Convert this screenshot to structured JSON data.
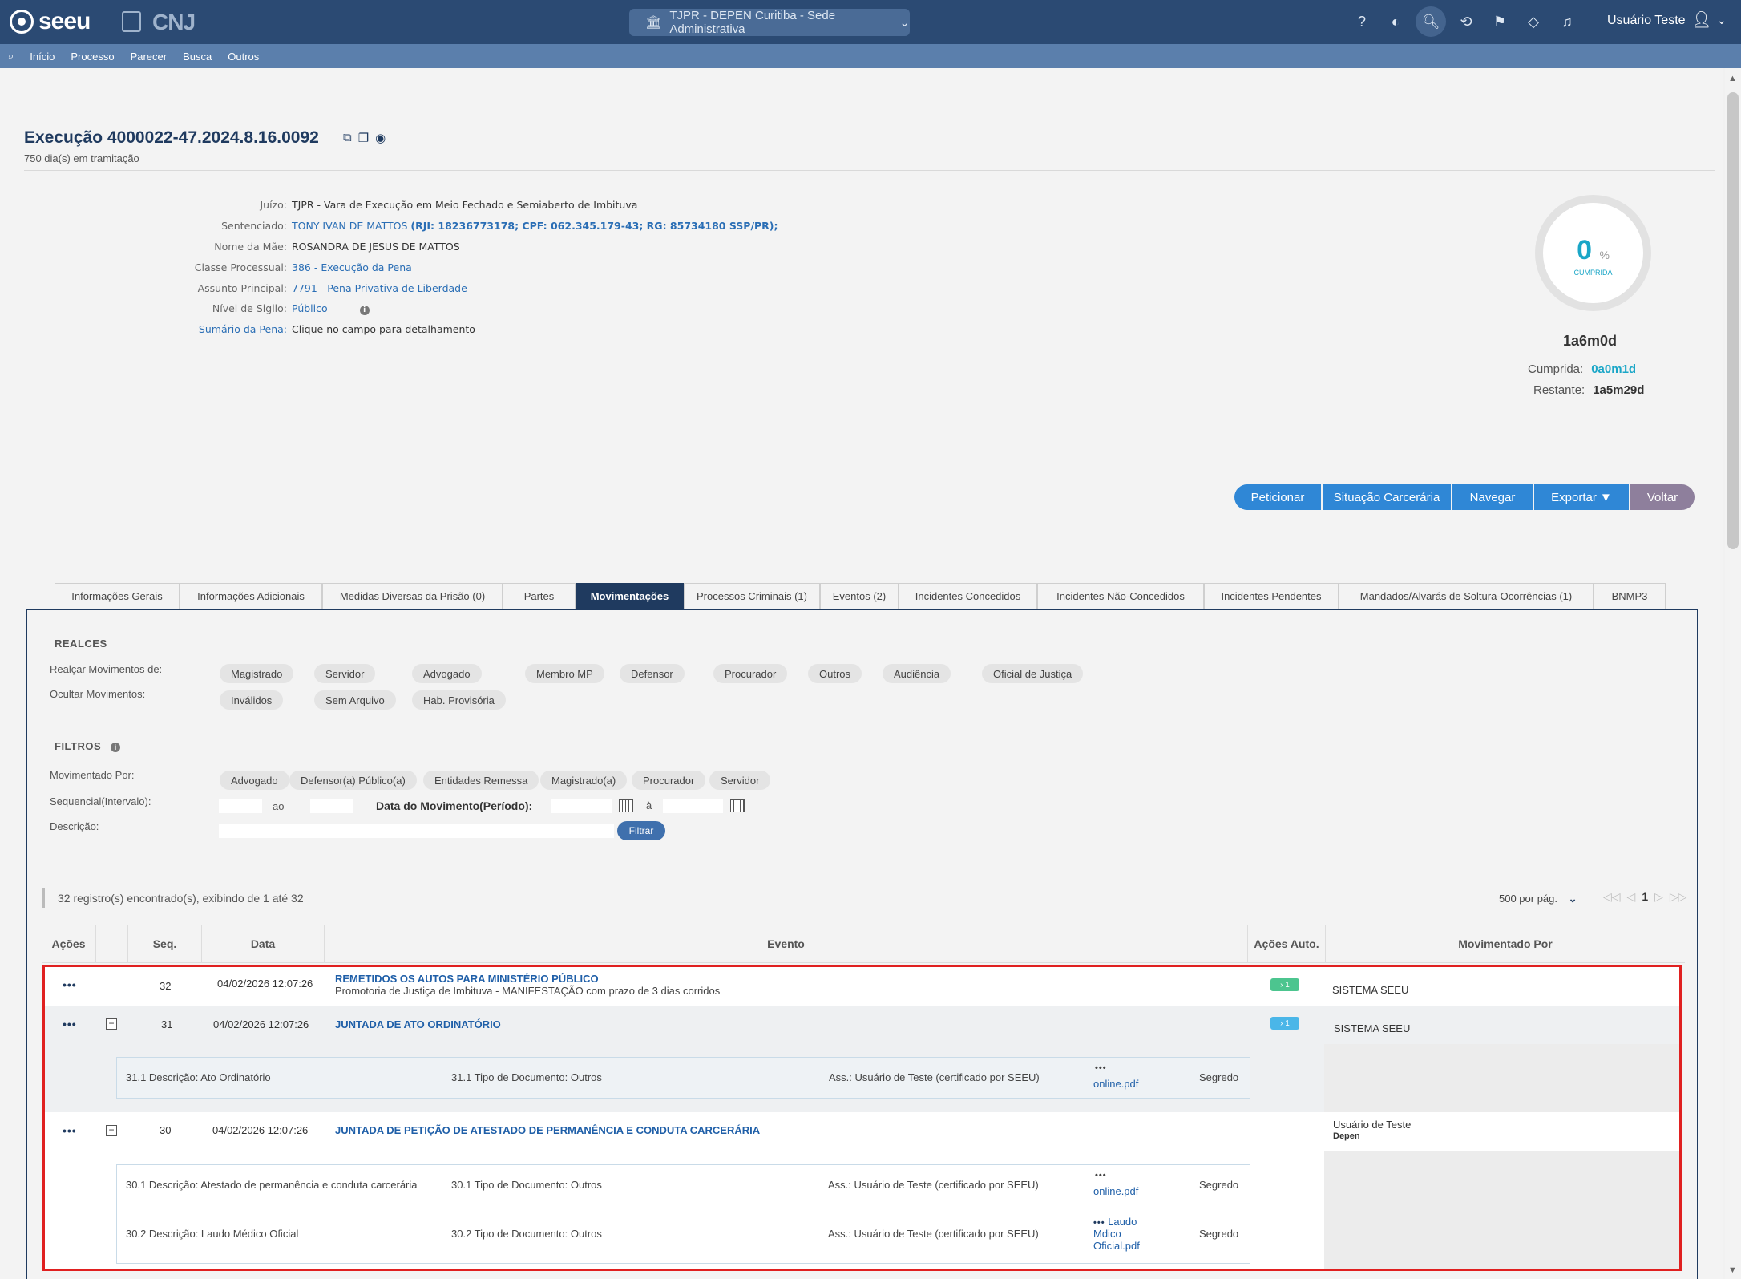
{
  "header": {
    "logo": "seeu",
    "cnj": "CNJ",
    "org_select": "TJPR - DEPEN Curitiba - Sede Administrativa",
    "user_name": "Usuário Teste"
  },
  "nav": {
    "items": [
      "Início",
      "Processo",
      "Parecer",
      "Busca",
      "Outros"
    ]
  },
  "page": {
    "title": "Execução 4000022-47.2024.8.16.0092",
    "subtitle": "750 dia(s) em tramitação"
  },
  "info": {
    "juizo_label": "Juízo:",
    "juizo": "TJPR - Vara de Execução em Meio Fechado e Semiaberto de Imbituva",
    "sentenciado_label": "Sentenciado:",
    "sentenciado_name": "TONY IVAN DE MATTOS",
    "sentenciado_docs": "(RJI: 18236773178; CPF: 062.345.179-43; RG: 85734180 SSP/PR);",
    "mae_label": "Nome da Mãe:",
    "mae": "ROSANDRA DE JESUS DE MATTOS",
    "classe_label": "Classe Processual:",
    "classe": "386 - Execução da Pena",
    "assunto_label": "Assunto Principal:",
    "assunto": "7791 - Pena Privativa de Liberdade",
    "sigilo_label": "Nível de Sigilo:",
    "sigilo": "Público",
    "sumario_label": "Sumário da Pena:",
    "sumario": "Clique no campo para detalhamento"
  },
  "pena": {
    "percent": "0",
    "percent_sign": "%",
    "gauge_label": "CUMPRIDA",
    "total": "1a6m0d",
    "cumprida_label": "Cumprida:",
    "cumprida": "0a0m1d",
    "restante_label": "Restante:",
    "restante": "1a5m29d"
  },
  "actions": [
    "Peticionar",
    "Situação Carcerária",
    "Navegar",
    "Exportar ▼",
    "Voltar"
  ],
  "tabs": [
    "Informações Gerais",
    "Informações Adicionais",
    "Medidas Diversas da Prisão (0)",
    "Partes",
    "Movimentações",
    "Processos Criminais (1)",
    "Eventos (2)",
    "Incidentes Concedidos",
    "Incidentes Não-Concedidos",
    "Incidentes Pendentes",
    "Mandados/Alvarás de Soltura-Ocorrências (1)",
    "BNMP3"
  ],
  "realces": {
    "title": "REALCES",
    "realcar_label": "Realçar Movimentos de:",
    "realcar": [
      "Magistrado",
      "Servidor",
      "Advogado",
      "Membro MP",
      "Defensor",
      "Procurador",
      "Outros",
      "Audiência",
      "Oficial de Justiça"
    ],
    "ocultar_label": "Ocultar Movimentos:",
    "ocultar": [
      "Inválidos",
      "Sem Arquivo",
      "Hab. Provisória"
    ]
  },
  "filtros": {
    "title": "FILTROS",
    "movimentado_label": "Movimentado Por:",
    "movimentado": [
      "Advogado",
      "Defensor(a) Público(a)",
      "Entidades Remessa",
      "Magistrado(a)",
      "Procurador",
      "Servidor"
    ],
    "sequencial_label": "Sequencial(Intervalo):",
    "ao": "ao",
    "data_label": "Data do Movimento(Período):",
    "a": "à",
    "descricao_label": "Descrição:",
    "filtrar": "Filtrar"
  },
  "results": {
    "summary": "32 registro(s) encontrado(s), exibindo de 1 até 32",
    "page_size": "500 por pág.",
    "current_page": "1"
  },
  "table": {
    "headers": [
      "Ações",
      "Seq.",
      "Data",
      "Evento",
      "Ações Auto.",
      "Movimentado Por"
    ],
    "rows": [
      {
        "actions": "•••",
        "seq": "32",
        "date": "04/02/2026 12:07:26",
        "title": "REMETIDOS OS AUTOS PARA MINISTÉRIO PÚBLICO",
        "desc": "Promotoria de Justiça de Imbituva - MANIFESTAÇÃO com prazo de 3 dias corridos",
        "auto": "› 1",
        "by": "SISTEMA SEEU"
      },
      {
        "actions": "•••",
        "toggle": "−",
        "seq": "31",
        "date": "04/02/2026 12:07:26",
        "title": "JUNTADA DE ATO ORDINATÓRIO",
        "auto": "› 1",
        "by": "SISTEMA SEEU",
        "docs": [
          {
            "descricao": "31.1 Descrição: Ato Ordinatório",
            "tipo": "31.1 Tipo de Documento: Outros",
            "ass": "Ass.: Usuário de Teste (certificado por SEEU)",
            "dots": "•••",
            "file": "online.pdf",
            "sigilo": "Segredo"
          }
        ]
      },
      {
        "actions": "•••",
        "toggle": "−",
        "seq": "30",
        "date": "04/02/2026 12:07:26",
        "title": "JUNTADA DE PETIÇÃO DE ATESTADO DE PERMANÊNCIA E CONDUTA CARCERÁRIA",
        "by": "Usuário de Teste",
        "by_sub": "Depen",
        "docs": [
          {
            "descricao": "30.1 Descrição: Atestado de permanência e conduta carcerária",
            "tipo": "30.1 Tipo de Documento: Outros",
            "ass": "Ass.: Usuário de Teste (certificado por SEEU)",
            "dots": "•••",
            "file": "online.pdf",
            "sigilo": "Segredo"
          },
          {
            "descricao": "30.2 Descrição: Laudo Médico Oficial",
            "tipo": "30.2 Tipo de Documento: Outros",
            "ass": "Ass.: Usuário de Teste (certificado por SEEU)",
            "dots": "•••",
            "file_line1": "Laudo",
            "file_line2": "Mdico",
            "file_line3": "Oficial.pdf",
            "sigilo": "Segredo"
          }
        ]
      }
    ]
  },
  "colors": {
    "header": "#2b4a73",
    "nav": "#5b7fac",
    "accent": "#2f87d6",
    "highlight_frame": "#e02020"
  }
}
